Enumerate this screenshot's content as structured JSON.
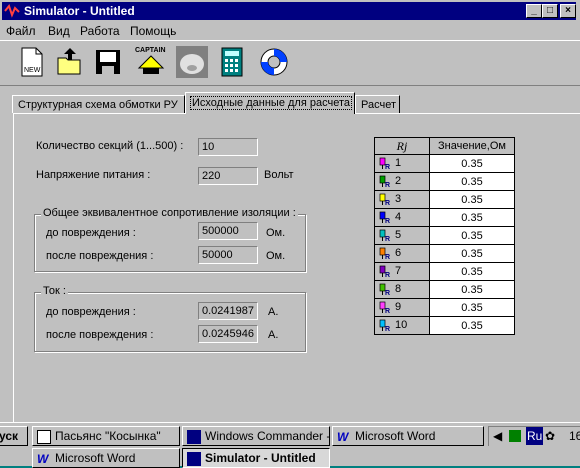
{
  "window": {
    "title": "Simulator - Untitled"
  },
  "menu": [
    "Файл",
    "Вид",
    "Работа",
    "Помощь"
  ],
  "toolbar": {
    "captain_label": "CAPTAIN",
    "new_label": "NEW"
  },
  "tabs": [
    "Структурная схема обмотки РУ",
    "Исходные данные для расчета",
    "Расчет"
  ],
  "form": {
    "sections_label": "Количество секций (1...500) :",
    "sections_value": "10",
    "voltage_label": "Напряжение питания :",
    "voltage_value": "220",
    "voltage_unit": "Вольт",
    "resistance_group": "Общее эквивалентное сопротивление изоляции :",
    "before_label": "до повреждения :",
    "before_value": "500000",
    "after_label": "после повреждения :",
    "after_value": "50000",
    "ohm_unit": "Ом.",
    "current_group": "Ток :",
    "current_before_label": "до повреждения :",
    "current_before_value": "0.0241987",
    "current_after_label": "после повреждения :",
    "current_after_value": "0.0245946",
    "amp_unit": "А."
  },
  "table": {
    "col_key": "Rj",
    "col_value": "Значение,Ом",
    "rows": [
      {
        "n": "1",
        "v": "0.35"
      },
      {
        "n": "2",
        "v": "0.35"
      },
      {
        "n": "3",
        "v": "0.35"
      },
      {
        "n": "4",
        "v": "0.35"
      },
      {
        "n": "5",
        "v": "0.35"
      },
      {
        "n": "6",
        "v": "0.35"
      },
      {
        "n": "7",
        "v": "0.35"
      },
      {
        "n": "8",
        "v": "0.35"
      },
      {
        "n": "9",
        "v": "0.35"
      },
      {
        "n": "10",
        "v": "0.35"
      }
    ],
    "icon_colors": [
      "#ff00ff",
      "#00a000",
      "#ffff00",
      "#0000ff",
      "#00c0c0",
      "#ff8000",
      "#8000c0",
      "#40c000",
      "#ff40ff",
      "#00c0ff"
    ]
  },
  "taskbar": {
    "start": "уск",
    "buttons": [
      "Пасьянс \"Косынка\"",
      "Windows Commander - ...",
      "Microsoft Word",
      "Microsoft Word",
      "Simulator - Untitled"
    ],
    "tray_lang": "Ru",
    "tray_time": "16"
  }
}
